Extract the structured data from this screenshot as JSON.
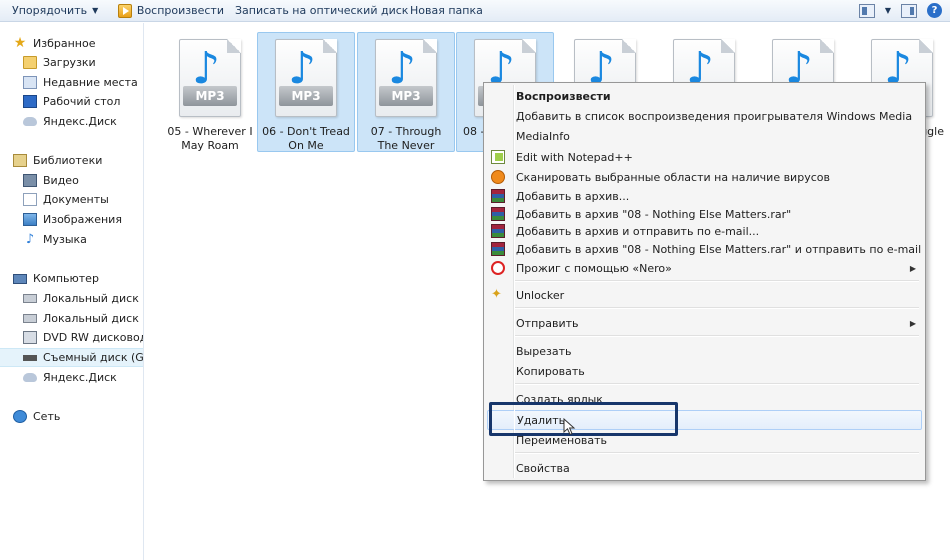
{
  "toolbar": {
    "organize": "Упорядочить",
    "play": "Воспроизвести",
    "burn": "Записать на оптический диск",
    "new_folder": "Новая папка"
  },
  "sidebar": {
    "favorites": "Избранное",
    "downloads": "Загрузки",
    "recent": "Недавние места",
    "desktop": "Рабочий стол",
    "yadisk1": "Яндекс.Диск",
    "libraries": "Библиотеки",
    "video": "Видео",
    "documents": "Документы",
    "images": "Изображения",
    "music": "Музыка",
    "computer": "Компьютер",
    "disk_c": "Локальный диск (C",
    "disk_d": "Локальный диск (D",
    "dvd": "DVD RW дисковод (",
    "removable": "Съемный диск (G:)",
    "yadisk2": "Яндекс.Диск",
    "network": "Сеть"
  },
  "files": [
    {
      "name": "05 - Wherever I May Roam",
      "type": "MP3"
    },
    {
      "name": "06 - Don't Tread On Me",
      "type": "MP3"
    },
    {
      "name": "07 - Through The Never",
      "type": "MP3"
    },
    {
      "name": "08 -",
      "type": "MP3"
    },
    {
      "name": "",
      "type": "MP3"
    },
    {
      "name": "",
      "type": "MP3"
    },
    {
      "name": "",
      "type": "MP3"
    },
    {
      "name": "ggle",
      "type": "MP3"
    }
  ],
  "menu": {
    "play": "Воспроизвести",
    "add_wmp": "Добавить в список воспроизведения проигрывателя Windows Media",
    "mediainfo": "MediaInfo",
    "notepad": "Edit with Notepad++",
    "scan": "Сканировать выбранные области на наличие вирусов",
    "add_archive": "Добавить в архив...",
    "add_rar": "Добавить в архив \"08 - Nothing Else Matters.rar\"",
    "add_email": "Добавить в архив и отправить по e-mail...",
    "add_rar_email": "Добавить в архив \"08 - Nothing Else Matters.rar\" и отправить по e-mail",
    "nero": "Прожиг с помощью «Nero»",
    "unlocker": "Unlocker",
    "send_to": "Отправить",
    "cut": "Вырезать",
    "copy": "Копировать",
    "shortcut": "Создать ярлык",
    "delete": "Удалить",
    "rename": "Переименовать",
    "properties": "Свойства"
  },
  "colors": {
    "selection": "#cce4f8",
    "highlight_border": "#17366b",
    "note_blue": "#1a88e0"
  }
}
